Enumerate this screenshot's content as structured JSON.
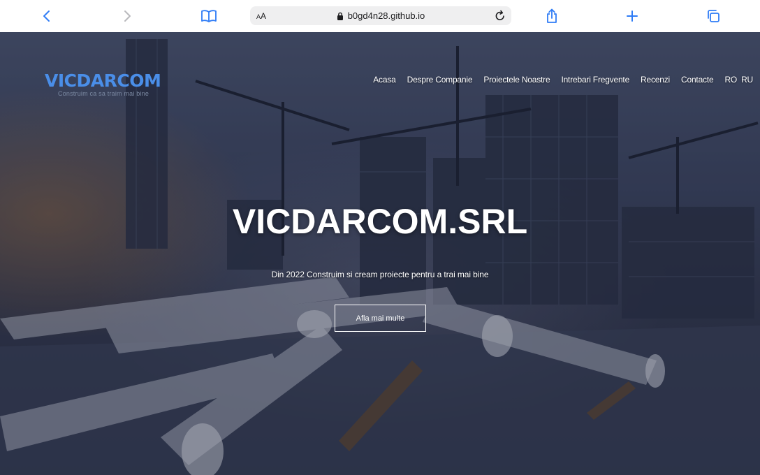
{
  "browser": {
    "url": "b0gd4n28.github.io",
    "reader_label_big": "A",
    "reader_label_small": "A",
    "accent": "#2f7cf6"
  },
  "header": {
    "logo_title": "VICDARCOM",
    "logo_tagline": "Construim ca sa traim mai bine",
    "nav": [
      {
        "label": "Acasa"
      },
      {
        "label": "Despre Companie"
      },
      {
        "label": "Proiectele Noastre"
      },
      {
        "label": "Intrebari Fregvente"
      },
      {
        "label": "Recenzi"
      },
      {
        "label": "Contacte"
      }
    ],
    "languages": [
      "RO",
      "RU"
    ]
  },
  "hero": {
    "title": "VICDARCOM.SRL",
    "subtitle": "Din 2022 Construim si cream proiecte pentru a trai mai bine",
    "cta_label": "Afla mai multe"
  },
  "colors": {
    "logo": "#4a8ee8",
    "text": "#ffffff"
  }
}
